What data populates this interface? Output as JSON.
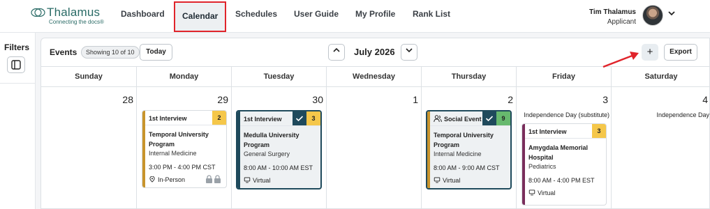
{
  "brand": {
    "name": "Thalamus",
    "tagline": "Connecting the docs®"
  },
  "nav": {
    "items": [
      {
        "label": "Dashboard"
      },
      {
        "label": "Calendar",
        "active": true
      },
      {
        "label": "Schedules"
      },
      {
        "label": "User Guide"
      },
      {
        "label": "My Profile"
      },
      {
        "label": "Rank List"
      }
    ]
  },
  "user": {
    "name": "Tim Thalamus",
    "role": "Applicant"
  },
  "filters": {
    "title": "Filters"
  },
  "toolbar": {
    "events_label": "Events",
    "showing": "Showing 10 of 10",
    "today": "Today",
    "month": "July 2026",
    "add": "+",
    "export": "Export"
  },
  "weekdays": [
    "Sunday",
    "Monday",
    "Tuesday",
    "Wednesday",
    "Thursday",
    "Friday",
    "Saturday"
  ],
  "days": [
    {
      "num": "28"
    },
    {
      "num": "29"
    },
    {
      "num": "30"
    },
    {
      "num": "1"
    },
    {
      "num": "2"
    },
    {
      "num": "3",
      "holiday": "Independence Day (substitute)"
    },
    {
      "num": "4",
      "holiday": "Independence Day"
    }
  ],
  "events": [
    {
      "type": "1st Interview",
      "rank": "2",
      "program": "Temporal University Program",
      "specialty": "Internal Medicine",
      "time": "3:00 PM - 4:00 PM CST",
      "location": "In-Person",
      "color": "#c8942c"
    },
    {
      "type": "1st Interview",
      "rank": "3",
      "program": "Medulla University Program",
      "specialty": "General Surgery",
      "time": "8:00 AM - 10:00 AM EST",
      "location": "Virtual",
      "color": "#1f4a5c"
    },
    {
      "type": "Social Event",
      "rank": "9",
      "program": "Temporal University Program",
      "specialty": "Internal Medicine",
      "time": "8:00 AM - 9:00 AM CST",
      "location": "Virtual",
      "color": "#c8942c"
    },
    {
      "type": "1st Interview",
      "rank": "3",
      "program": "Amygdala Memorial Hospital",
      "specialty": "Pediatrics",
      "time": "8:00 AM - 4:00 PM EST",
      "location": "Virtual",
      "color": "#7a2e5c"
    }
  ],
  "colors": {
    "accent": "#2a6b66",
    "highlight": "#e0242b",
    "rank_yellow": "#f5c74a",
    "rank_green": "#67b96e",
    "confirmed": "#1f4a5c"
  }
}
